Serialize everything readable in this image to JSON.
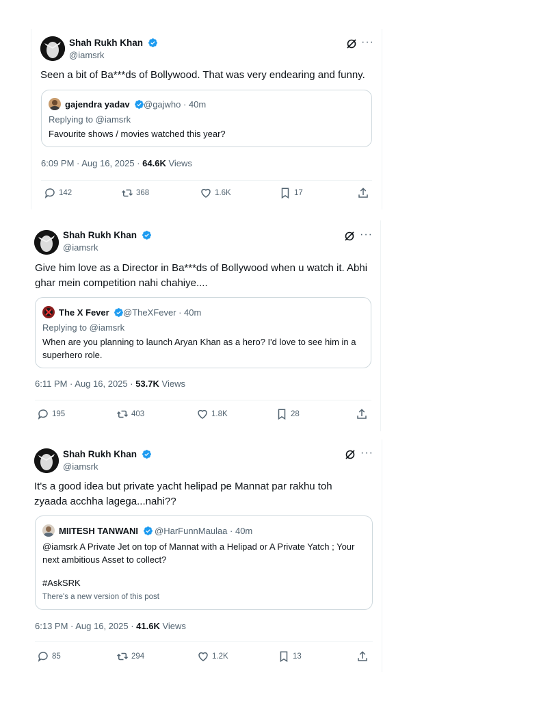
{
  "posts": [
    {
      "author_name": "Shah Rukh Khan",
      "author_handle": "@iamsrk",
      "text": "Seen a bit of Ba***ds of Bollywood. That was very endearing and funny.",
      "quote": {
        "name": "gajendra yadav",
        "handle": "@gajwho · 40m",
        "replying_to": "Replying to @iamsrk",
        "text": "Favourite shows / movies watched this year?",
        "note": ""
      },
      "timestamp": "6:09 PM · Aug 16, 2025 · ",
      "views_count": "64.6K",
      "views_label": "Views",
      "replies": "142",
      "reposts": "368",
      "likes": "1.6K",
      "bookmarks": "17"
    },
    {
      "author_name": "Shah Rukh Khan",
      "author_handle": "@iamsrk",
      "text": "Give him love as a Director in Ba***ds of Bollywood when u watch it. Abhi ghar mein competition nahi chahiye....",
      "quote": {
        "name": "The X Fever",
        "handle": "@TheXFever · 40m",
        "replying_to": "Replying to @iamsrk",
        "text": "When are you planning to launch Aryan Khan as a hero? I'd love to see him in a superhero role.",
        "note": ""
      },
      "timestamp": "6:11 PM · Aug 16, 2025 · ",
      "views_count": "53.7K",
      "views_label": "Views",
      "replies": "195",
      "reposts": "403",
      "likes": "1.8K",
      "bookmarks": "28"
    },
    {
      "author_name": "Shah Rukh Khan",
      "author_handle": "@iamsrk",
      "text": "It's a good idea but private yacht helipad pe Mannat par rakhu toh zyaada acchha lagega...nahi??",
      "quote": {
        "name": "MIITESH TANWANI",
        "handle": "@HarFunnMaulaa · 40m",
        "replying_to": "",
        "text": "@iamsrk A Private Jet on top of Mannat with a Helipad or A Private Yatch ; Your next ambitious Asset to collect?",
        "hashtag": "#AskSRK",
        "note": "There's a new version of this post"
      },
      "timestamp": "6:13 PM · Aug 16, 2025 · ",
      "views_count": "41.6K",
      "views_label": "Views",
      "replies": "85",
      "reposts": "294",
      "likes": "1.2K",
      "bookmarks": "13"
    }
  ],
  "colors": {
    "verified_blue": "#1d9bf0",
    "secondary_text": "#536471",
    "primary_text": "#0f1419",
    "border": "#cfd9de"
  },
  "icons": [
    "verified-badge-icon",
    "grok-icon",
    "more-icon",
    "reply-icon",
    "repost-icon",
    "like-icon",
    "bookmark-icon",
    "share-icon"
  ]
}
